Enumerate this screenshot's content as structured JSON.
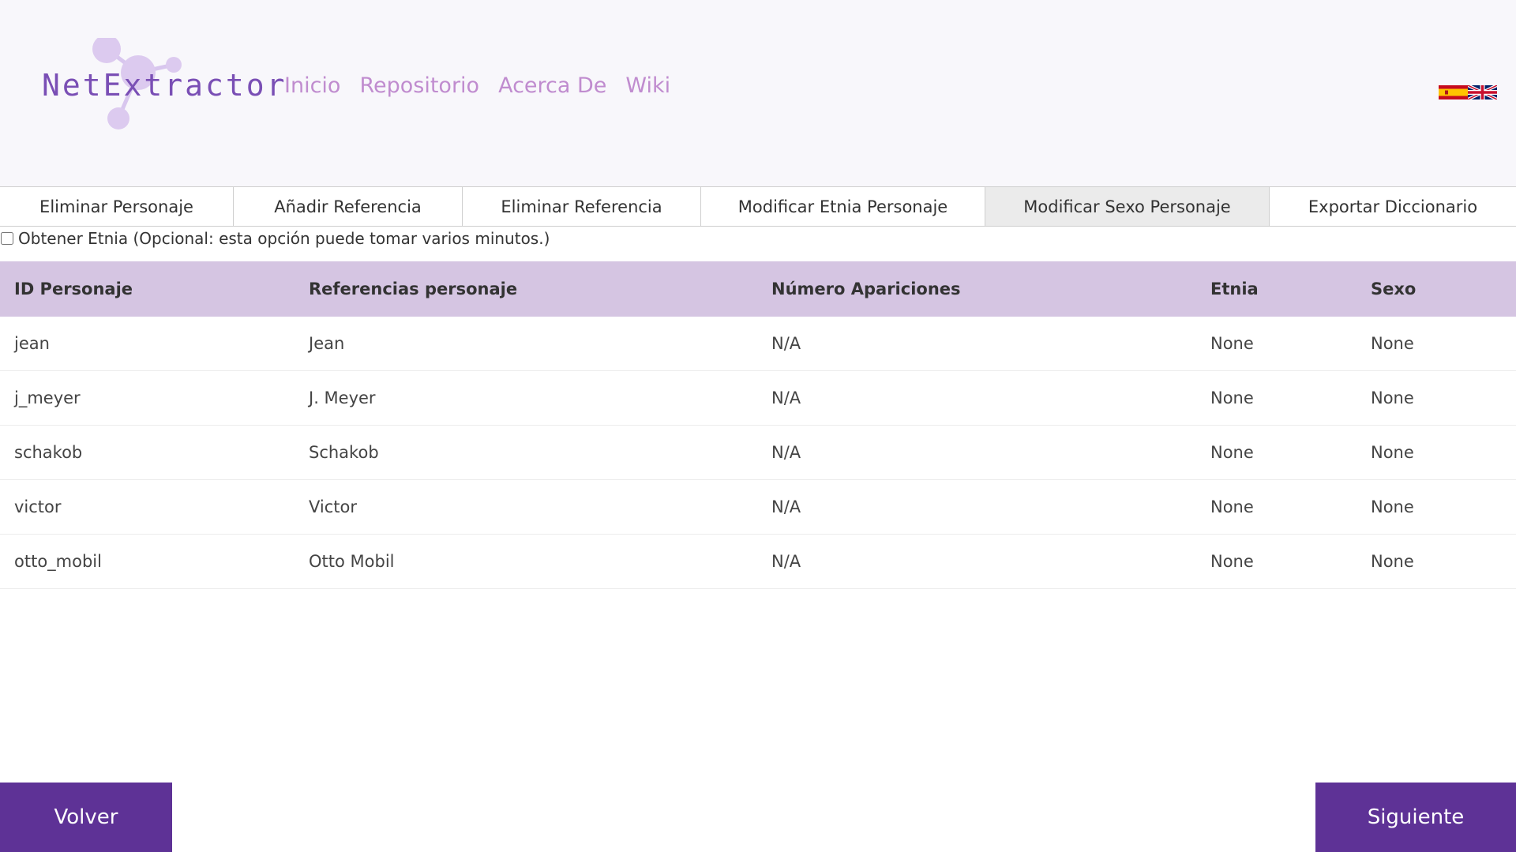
{
  "brand": {
    "logo_text": "NetExtractor",
    "color": "#7a4fb5"
  },
  "nav": [
    {
      "label": "Inicio"
    },
    {
      "label": "Repositorio"
    },
    {
      "label": "Acerca De"
    },
    {
      "label": "Wiki"
    }
  ],
  "languages": [
    "es-flag-icon",
    "uk-flag-icon"
  ],
  "tabs": [
    {
      "label": "Eliminar Personaje",
      "active": false
    },
    {
      "label": "Añadir Referencia",
      "active": false
    },
    {
      "label": "Eliminar Referencia",
      "active": false
    },
    {
      "label": "Modificar Etnia Personaje",
      "active": false
    },
    {
      "label": "Modificar Sexo Personaje",
      "active": true
    },
    {
      "label": "Exportar Diccionario",
      "active": false
    }
  ],
  "option": {
    "checked": false,
    "label": "Obtener Etnia (Opcional: esta opción puede tomar varios minutos.)"
  },
  "table": {
    "headers": [
      "ID Personaje",
      "Referencias personaje",
      "Número Apariciones",
      "Etnia",
      "Sexo"
    ],
    "rows": [
      [
        "jean",
        "Jean",
        "N/A",
        "None",
        "None"
      ],
      [
        "j_meyer",
        "J. Meyer",
        "N/A",
        "None",
        "None"
      ],
      [
        "schakob",
        "Schakob",
        "N/A",
        "None",
        "None"
      ],
      [
        "victor",
        "Victor",
        "N/A",
        "None",
        "None"
      ],
      [
        "otto_mobil",
        "Otto Mobil",
        "N/A",
        "None",
        "None"
      ]
    ]
  },
  "buttons": {
    "back": "Volver",
    "next": "Siguiente"
  },
  "colors": {
    "accent": "#5e3296",
    "table_header": "#d5c5e2",
    "nav": "#c08ccf"
  }
}
